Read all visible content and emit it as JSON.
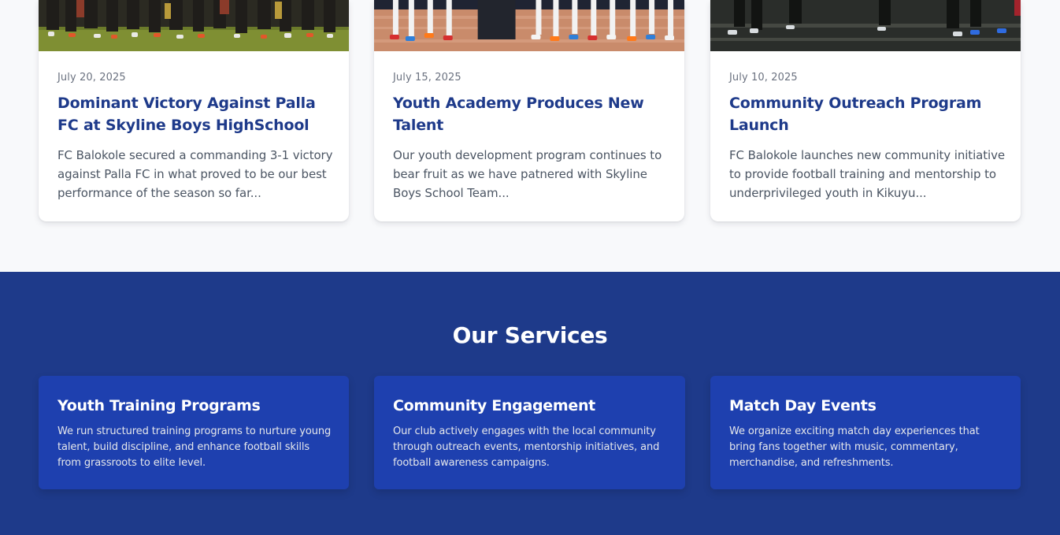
{
  "news": {
    "cards": [
      {
        "date": "July 20, 2025",
        "title": "Dominant Victory Against Palla FC at Skyline Boys HighSchool",
        "excerpt": "FC Balokole secured a commanding 3-1 victory against Palla FC in what proved to be our best performance of the season so far..."
      },
      {
        "date": "July 15, 2025",
        "title": "Youth Academy Produces New Talent",
        "excerpt": "Our youth development program continues to bear fruit as we have patnered with Skyline Boys School Team..."
      },
      {
        "date": "July 10, 2025",
        "title": "Community Outreach Program Launch",
        "excerpt": "FC Balokole launches new community initiative to provide football training and mentorship to underprivileged youth in Kikuyu..."
      }
    ]
  },
  "services": {
    "title": "Our Services",
    "cards": [
      {
        "title": "Youth Training Programs",
        "description": "We run structured training programs to nurture young talent, build discipline, and enhance football skills from grassroots to elite level."
      },
      {
        "title": "Community Engagement",
        "description": "Our club actively engages with the local community through outreach events, mentorship initiatives, and football awareness campaigns."
      },
      {
        "title": "Match Day Events",
        "description": "We organize exciting match day experiences that bring fans together with music, commentary, merchandise, and refreshments."
      }
    ]
  },
  "colors": {
    "page_background": "#f8f9fb",
    "news_title": "#1e3a8a",
    "services_background": "#1e3a8a",
    "service_card": "#1e40af"
  }
}
